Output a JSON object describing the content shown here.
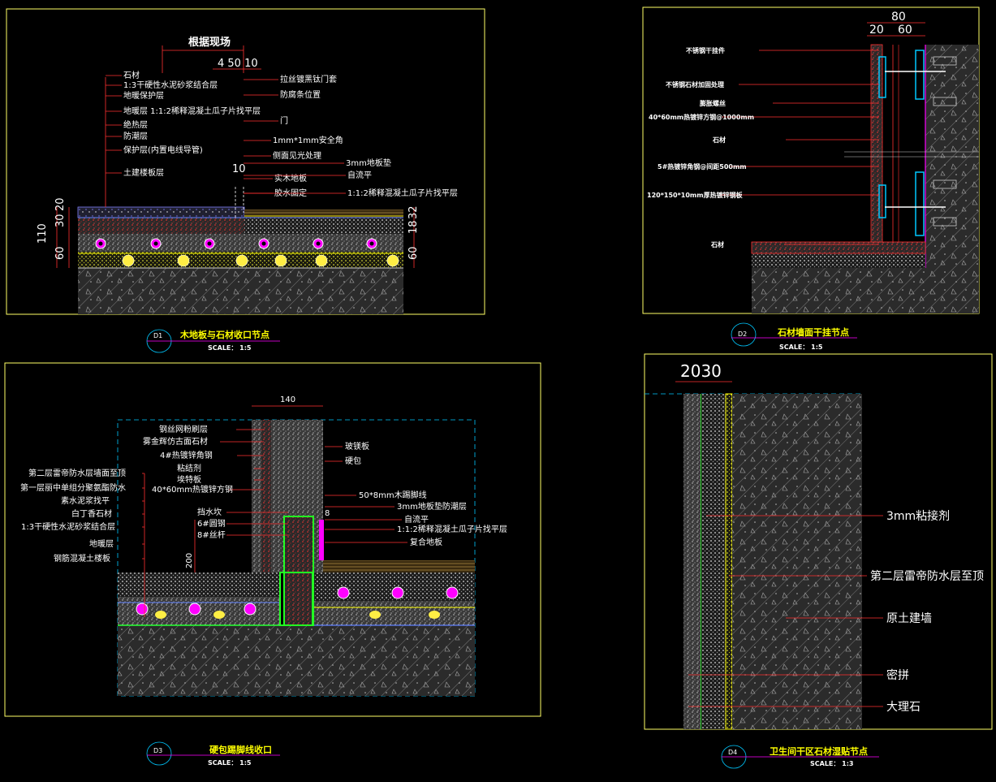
{
  "colors": {
    "frame": "#ffff66",
    "leader": "#ff2a2a",
    "dim": "#ff3030",
    "cyan": "#00c8ff",
    "green": "#22ff22",
    "magenta": "#ff00ff"
  },
  "d1": {
    "label": "D1",
    "title": "木地板与石材收口节点",
    "scale": "SCALE： 1:5",
    "dim_top": "根据现场",
    "dim_sub": "4 50 10",
    "left_labels": [
      "石材",
      "1:3干硬性水泥砂浆结合层",
      "地暖保护层",
      "地暖层 1:1:2稀释混凝土瓜子片找平层",
      "绝热层",
      "防潮层",
      "保护层(内置电线导管)",
      "土建楼板层"
    ],
    "right_labels": [
      "拉丝镀黑钛门套",
      "防腐条位置",
      "门",
      "1mm*1mm安全角",
      "侧面见光处理",
      "实木地板",
      "胶水固定",
      "3mm地板垫",
      "自流平",
      "1:1:2稀释混凝土瓜子片找平层"
    ],
    "dim_10": "10",
    "dim_left": [
      "110",
      "30",
      "20",
      "60"
    ],
    "dim_right": [
      "32",
      "18",
      "60"
    ]
  },
  "d2": {
    "label": "D2",
    "title": "石材墙面干挂节点",
    "scale": "SCALE： 1:5",
    "dim_top": "80",
    "dim_sub": [
      "20",
      "60"
    ],
    "labels": [
      "不锈钢干挂件",
      "不锈钢石材加固处理",
      "膨胀螺丝",
      "40*60mm热镀锌方钢@1000mm",
      "石材",
      "5#热镀锌角钢@间距500mm",
      "120*150*10mm厚热镀锌钢板",
      "石材"
    ]
  },
  "d3": {
    "label": "D3",
    "title": "硬包踢脚线收口",
    "scale": "SCALE： 1:5",
    "dim_top": "140",
    "dim_200": "200",
    "dim_8": "8",
    "left_labels": [
      "钢丝网粉刷层",
      "雾金辉仿古面石材",
      "4#热镀锌角钢",
      "粘结剂",
      "埃特板",
      "40*60mm热镀锌方钢"
    ],
    "far_left_labels": [
      "第二层雷帝防水层墙面至顶",
      "第一层丽中单组分聚氨酯防水",
      "素水泥浆找平",
      "白丁香石材",
      "1:3干硬性水泥砂浆结合层",
      "地暖层",
      "钢筋混凝土楼板"
    ],
    "mid_labels": [
      "挡水坎",
      "6#圆钢",
      "8#丝杆"
    ],
    "right_labels": [
      "玻镁板",
      "硬包",
      "50*8mm木踢脚线",
      "3mm地板垫防潮层",
      "自流平",
      "1:1:2稀释混凝土瓜子片找平层",
      "复合地板"
    ]
  },
  "d4": {
    "label": "D4",
    "title": "卫生间干区石材湿贴节点",
    "scale": "SCALE： 1:3",
    "dim_top": "2030",
    "labels": [
      "3mm粘接剂",
      "第二层雷帝防水层至顶",
      "原土建墙",
      "密拼",
      "大理石"
    ]
  }
}
